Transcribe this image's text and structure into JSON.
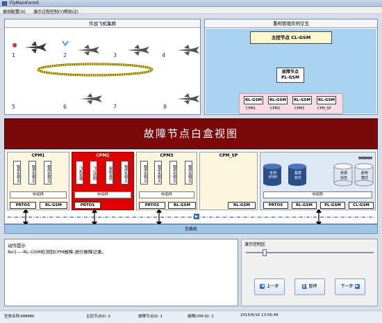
{
  "window": {
    "title": "FlyMainForm0"
  },
  "menu": [
    "案例配置(X)",
    "演示过程控制(Y)",
    "帮助(Z)"
  ],
  "formation": {
    "title": "作战飞机集群",
    "numbers": [
      "1",
      "2",
      "3",
      "4",
      "5",
      "6",
      "7",
      "8"
    ]
  },
  "reconfig": {
    "title": "重构管理实例交互",
    "master": "主控节点 CL-GSM",
    "fault_node_line1": "故障节点",
    "fault_node_line2": "PL-GSM",
    "rl_labels": [
      "RL-GSM",
      "RL-GSM",
      "RL-GSM",
      "RL-GSM"
    ],
    "cpm_labels": [
      "CPM1",
      "CPM2",
      "CPM3",
      "CPM_SP"
    ]
  },
  "banner": "故障节点白盒视图",
  "whitebox": {
    "cpm1": {
      "title": "CPM1",
      "apps": [
        "程序名称五",
        "程序名称五",
        "程序名称五"
      ],
      "mw": "中间件",
      "os": "PRTOS",
      "rl": "RL-GSM"
    },
    "cpm2": {
      "title": "CPM2",
      "apps": [
        "飞机管理",
        "飞行控制",
        "座舱显控",
        "程序名称五"
      ],
      "mw": "中间件",
      "os": "PRTOS"
    },
    "cpm3": {
      "title": "CPM3",
      "apps": [
        "程序名称五",
        "程序名称五",
        "程序名称五",
        "程序名称五"
      ],
      "mw": "中间件",
      "os": "PRTOS",
      "rl": "RL-GSM"
    },
    "cpmsp": {
      "title": "CPM_SP",
      "rl": "RL-GSM"
    },
    "master": {
      "tag": "MMMM",
      "cyl": [
        "本地\nRTBP",
        "集群\n软件",
        "资源\n状态",
        "航电\n模式"
      ],
      "mw": "中间件",
      "bots": [
        "PRTOS",
        "RL-GSM",
        "PL-GSM",
        "CL-GSM"
      ]
    },
    "bus": "交换机"
  },
  "action": {
    "title": "动作提示",
    "text": "No1----RL-GSM检测到CPM故障,进行故障记录。"
  },
  "control": {
    "title": "演示控制区",
    "prev": "上一步",
    "pause": "暂停",
    "next": "下一步"
  },
  "status": {
    "task": "任务名称:MMMM",
    "master": "主控节点ID: 2",
    "fault": "故障节点ID: 1",
    "faultcpm": "故障CPM ID: 2",
    "time": "2015/6/16 13:56:49"
  }
}
